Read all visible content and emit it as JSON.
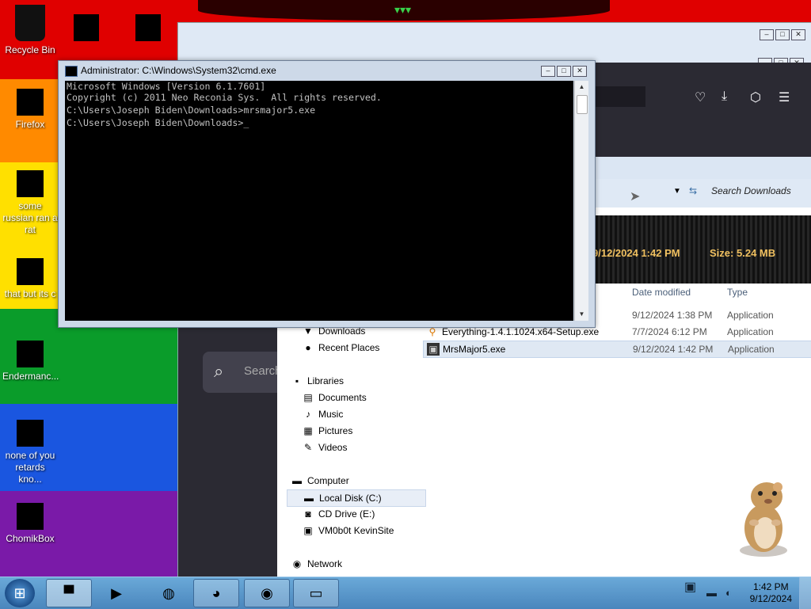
{
  "desktop": {
    "icons": [
      {
        "label": "Recycle Bin"
      },
      {
        "label": "Firefox"
      },
      {
        "label": "some russian ran a rat"
      },
      {
        "label": "that but its c"
      },
      {
        "label": "Endermanc..."
      },
      {
        "label": "none of you retards kno..."
      },
      {
        "label": "ChomikBox"
      }
    ]
  },
  "cmd": {
    "title": "Administrator: C:\\Windows\\System32\\cmd.exe",
    "lines": [
      "Microsoft Windows [Version 6.1.7601]",
      "Copyright (c) 2011 Neo Reconia Sys.  All rights reserved.",
      "",
      "C:\\Users\\Joseph Biden\\Downloads>mrsmajor5.exe",
      "",
      "C:\\Users\\Joseph Biden\\Downloads>_"
    ]
  },
  "browser": {
    "search_placeholder": "Search"
  },
  "explorer": {
    "search_placeholder": "Search Downloads",
    "details": {
      "modified": "9/12/2024 1:42 PM",
      "size_label": "Size:",
      "size": "5.24 MB"
    },
    "columns": {
      "date": "Date modified",
      "type": "Type"
    },
    "nav": {
      "favorites": [
        {
          "label": "Downloads",
          "icon": "downloads-icon"
        },
        {
          "label": "Recent Places",
          "icon": "recent-places-icon"
        }
      ],
      "libraries_label": "Libraries",
      "libraries": [
        {
          "label": "Documents",
          "icon": "documents-icon"
        },
        {
          "label": "Music",
          "icon": "music-icon"
        },
        {
          "label": "Pictures",
          "icon": "pictures-icon"
        },
        {
          "label": "Videos",
          "icon": "videos-icon"
        }
      ],
      "computer_label": "Computer",
      "drives": [
        {
          "label": "Local Disk (C:)",
          "icon": "hard-drive-icon"
        },
        {
          "label": "CD Drive (E:)",
          "icon": "cd-drive-icon"
        },
        {
          "label": "VM0b0t KevinSite",
          "icon": "network-drive-icon"
        }
      ],
      "network_label": "Network"
    },
    "files": [
      {
        "name": "",
        "date": "9/12/2024 1:38 PM",
        "type": "Application"
      },
      {
        "name": "Everything-1.4.1.1024.x64-Setup.exe",
        "date": "7/7/2024 6:12 PM",
        "type": "Application"
      },
      {
        "name": "MrsMajor5.exe",
        "date": "9/12/2024 1:42 PM",
        "type": "Application"
      }
    ]
  },
  "taskbar": {
    "time": "1:42 PM",
    "date": "9/12/2024"
  },
  "colors": {
    "taskbar": "#4a86bd",
    "console_bg": "#000000",
    "console_fg": "#c0c0c0",
    "details_text": "#f0c060"
  }
}
